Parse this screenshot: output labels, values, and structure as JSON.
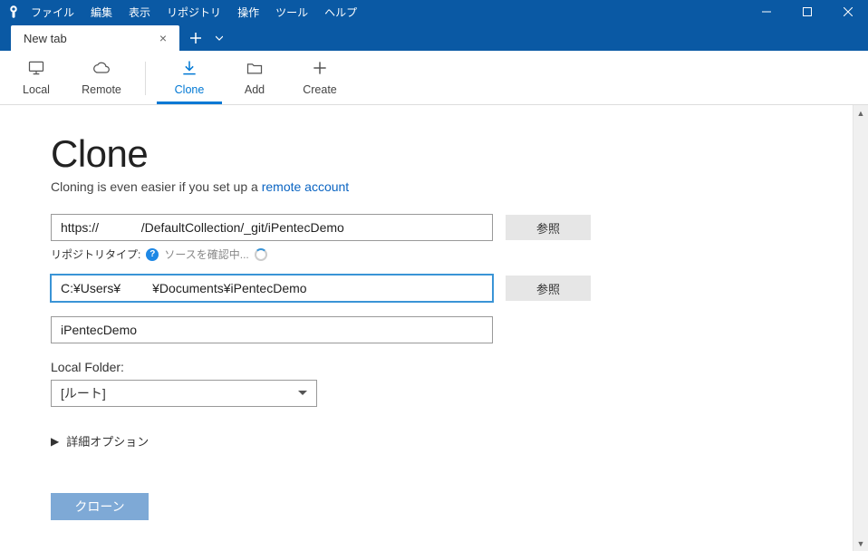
{
  "menu": {
    "items": [
      {
        "label": "ファイル"
      },
      {
        "label": "編集"
      },
      {
        "label": "表示"
      },
      {
        "label": "リポジトリ"
      },
      {
        "label": "操作"
      },
      {
        "label": "ツール"
      },
      {
        "label": "ヘルプ"
      }
    ]
  },
  "tabs": {
    "current_label": "New tab"
  },
  "toolbar": {
    "local": "Local",
    "remote": "Remote",
    "clone": "Clone",
    "add": "Add",
    "create": "Create"
  },
  "page": {
    "heading": "Clone",
    "tagline_before": "Cloning is even easier if you set up a ",
    "tagline_link": "remote account",
    "repo_url": "https://            /DefaultCollection/_git/iPentecDemo",
    "browse": "参照",
    "repo_type_label": "リポジトリタイプ:",
    "repo_type_status": "ソースを確認中...",
    "dest_path": "C:¥Users¥         ¥Documents¥iPentecDemo",
    "repo_name": "iPentecDemo",
    "local_folder_label": "Local Folder:",
    "local_folder_value": "[ルート]",
    "advanced_label": "詳細オプション",
    "clone_btn": "クローン"
  }
}
